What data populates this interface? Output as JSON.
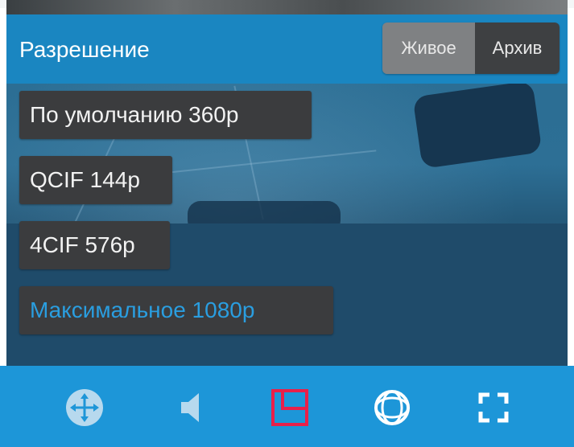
{
  "header": {
    "title": "Разрешение",
    "mode_tabs": [
      {
        "label": "Живое",
        "active": true
      },
      {
        "label": "Архив",
        "active": false
      }
    ]
  },
  "resolutions": [
    {
      "label": "По умолчанию 360p",
      "selected": false
    },
    {
      "label": "QCIF 144p",
      "selected": false
    },
    {
      "label": "4CIF 576p",
      "selected": false
    },
    {
      "label": "Максимальное 1080p",
      "selected": true
    }
  ],
  "toolbar": {
    "buttons": [
      {
        "icon": "ptz-move-icon"
      },
      {
        "icon": "speaker-icon"
      },
      {
        "icon": "layout-resolution-icon"
      },
      {
        "icon": "fisheye-icon"
      },
      {
        "icon": "fullscreen-icon"
      }
    ]
  },
  "colors": {
    "header_bg": "#1a86c1",
    "toolbar_bg": "#1d96d8",
    "option_bg": "#3b3c3e",
    "selected_text": "#2a9ee0",
    "active_icon": "#e8204a"
  }
}
